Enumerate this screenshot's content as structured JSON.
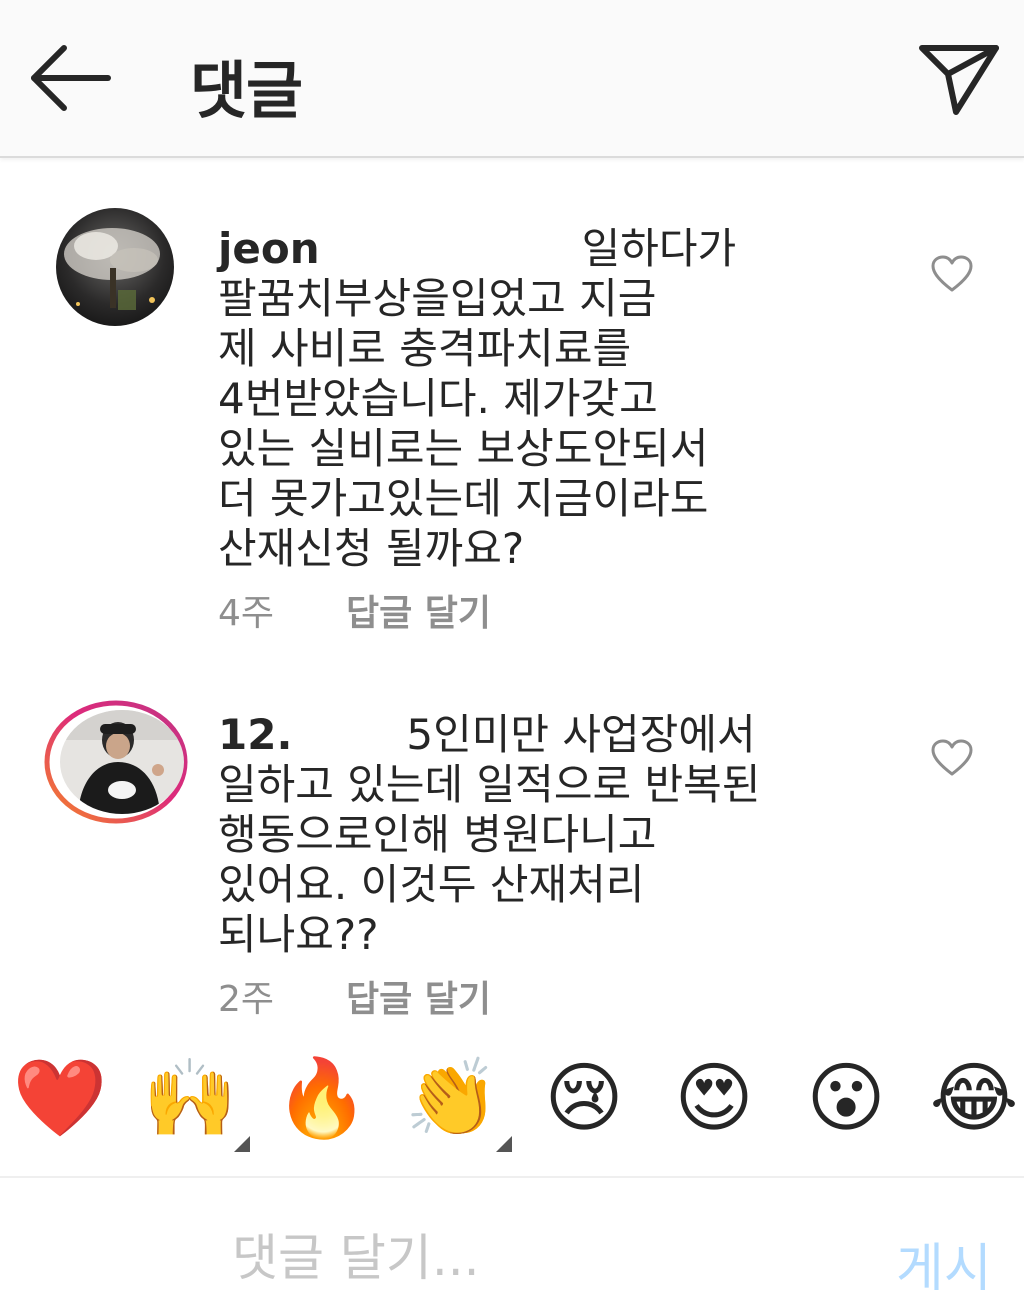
{
  "header": {
    "title": "댓글",
    "back_icon": "arrow-left-icon",
    "send_icon": "paper-plane-icon"
  },
  "comments": [
    {
      "username": "jeon",
      "text": "일하다가\n팔꿈치부상을입었고 지금\n제 사비로 충격파치료를\n4번받았습니다. 제가갖고\n있는 실비로는 보상도안되서\n더 못가고있는데 지금이라도\n산재신청 될까요?",
      "age": "4주",
      "reply_label": "답글 달기",
      "has_story_ring": false
    },
    {
      "username": "12.",
      "text": "5인미만 사업장에서\n일하고 있는데 일적으로 반복된\n행동으로인해 병원다니고\n있어요. 이것두 산재처리\n되나요??",
      "age": "2주",
      "reply_label": "답글 달기",
      "has_story_ring": true
    }
  ],
  "emoji_bar": [
    {
      "glyph": "❤️",
      "name": "red-heart"
    },
    {
      "glyph": "🙌",
      "name": "raising-hands",
      "has_variants": true
    },
    {
      "glyph": "🔥",
      "name": "fire"
    },
    {
      "glyph": "👏",
      "name": "clapping-hands",
      "has_variants": true
    },
    {
      "glyph": "😢",
      "name": "crying-face"
    },
    {
      "glyph": "😍",
      "name": "heart-eyes"
    },
    {
      "glyph": "😮",
      "name": "surprised-face"
    },
    {
      "glyph": "😂",
      "name": "tears-of-joy"
    }
  ],
  "input": {
    "placeholder": "댓글 달기...",
    "value": "",
    "post_label": "게시"
  },
  "colors": {
    "story_ring_start": "#f58529",
    "story_ring_end": "#dd2a7b",
    "post_disabled": "#b3dbff",
    "meta_gray": "#8e8e8e"
  }
}
